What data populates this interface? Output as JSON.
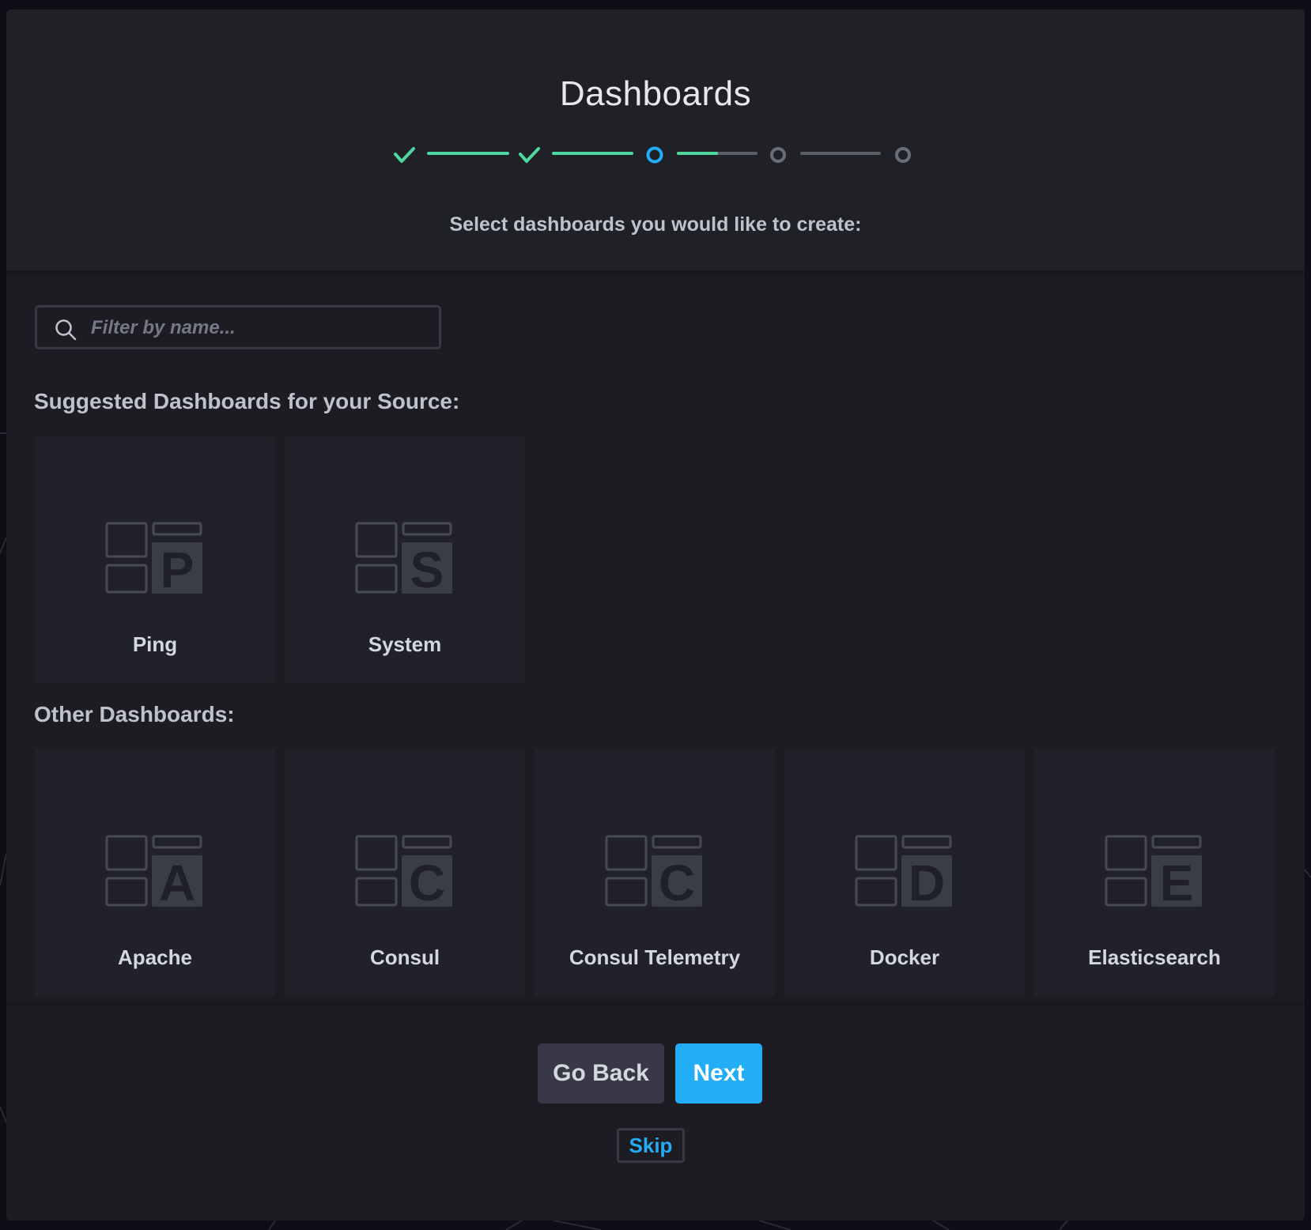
{
  "wizard": {
    "title": "Dashboards",
    "subtitle": "Select dashboards you would like to create:",
    "steps": [
      {
        "status": "complete"
      },
      {
        "status": "complete"
      },
      {
        "status": "current"
      },
      {
        "status": "incomplete"
      },
      {
        "status": "incomplete"
      }
    ]
  },
  "search": {
    "placeholder": "Filter by name...",
    "value": ""
  },
  "suggested": {
    "label": "Suggested Dashboards for your Source:",
    "cards": [
      {
        "name": "Ping",
        "letter": "P"
      },
      {
        "name": "System",
        "letter": "S"
      }
    ]
  },
  "other": {
    "label": "Other Dashboards:",
    "cards": [
      {
        "name": "Apache",
        "letter": "A"
      },
      {
        "name": "Consul",
        "letter": "C"
      },
      {
        "name": "Consul Telemetry",
        "letter": "C"
      },
      {
        "name": "Docker",
        "letter": "D"
      },
      {
        "name": "Elasticsearch",
        "letter": "E"
      }
    ]
  },
  "footer": {
    "back_label": "Go Back",
    "next_label": "Next",
    "skip_label": "Skip"
  },
  "colors": {
    "accent": "#22adf6",
    "success": "#4ed8a0",
    "card_bg": "#212129",
    "panel_bg": "#1c1c22"
  }
}
